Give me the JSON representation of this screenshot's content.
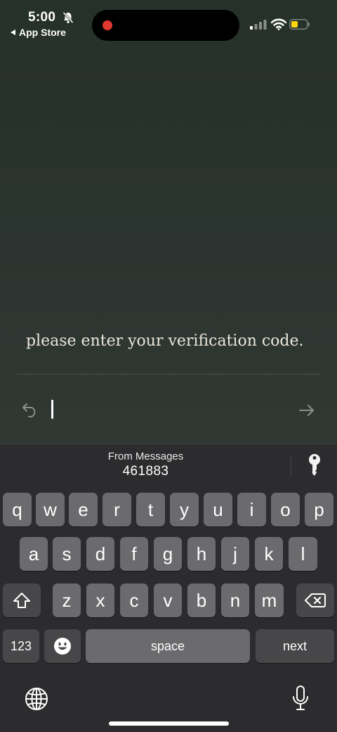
{
  "status_bar": {
    "time": "5:00",
    "back_app": "App Store",
    "recording": true,
    "battery_color": "#ffd60a"
  },
  "screen": {
    "prompt": "please enter your verification code.",
    "code_input_value": ""
  },
  "keyboard": {
    "suggestion_source": "From Messages",
    "suggestion_code": "461883",
    "row1": [
      "q",
      "w",
      "e",
      "r",
      "t",
      "y",
      "u",
      "i",
      "o",
      "p"
    ],
    "row2": [
      "a",
      "s",
      "d",
      "f",
      "g",
      "h",
      "j",
      "k",
      "l"
    ],
    "row3": [
      "z",
      "x",
      "c",
      "v",
      "b",
      "n",
      "m"
    ],
    "numbers_label": "123",
    "space_label": "space",
    "return_label": "next"
  },
  "icons": {
    "silent": "bell-slash-icon",
    "back": "undo-arrow-icon",
    "next": "right-arrow-icon",
    "password": "key-icon",
    "shift": "shift-icon",
    "delete": "backspace-icon",
    "emoji": "emoji-icon",
    "globe": "globe-icon",
    "mic": "microphone-icon"
  }
}
